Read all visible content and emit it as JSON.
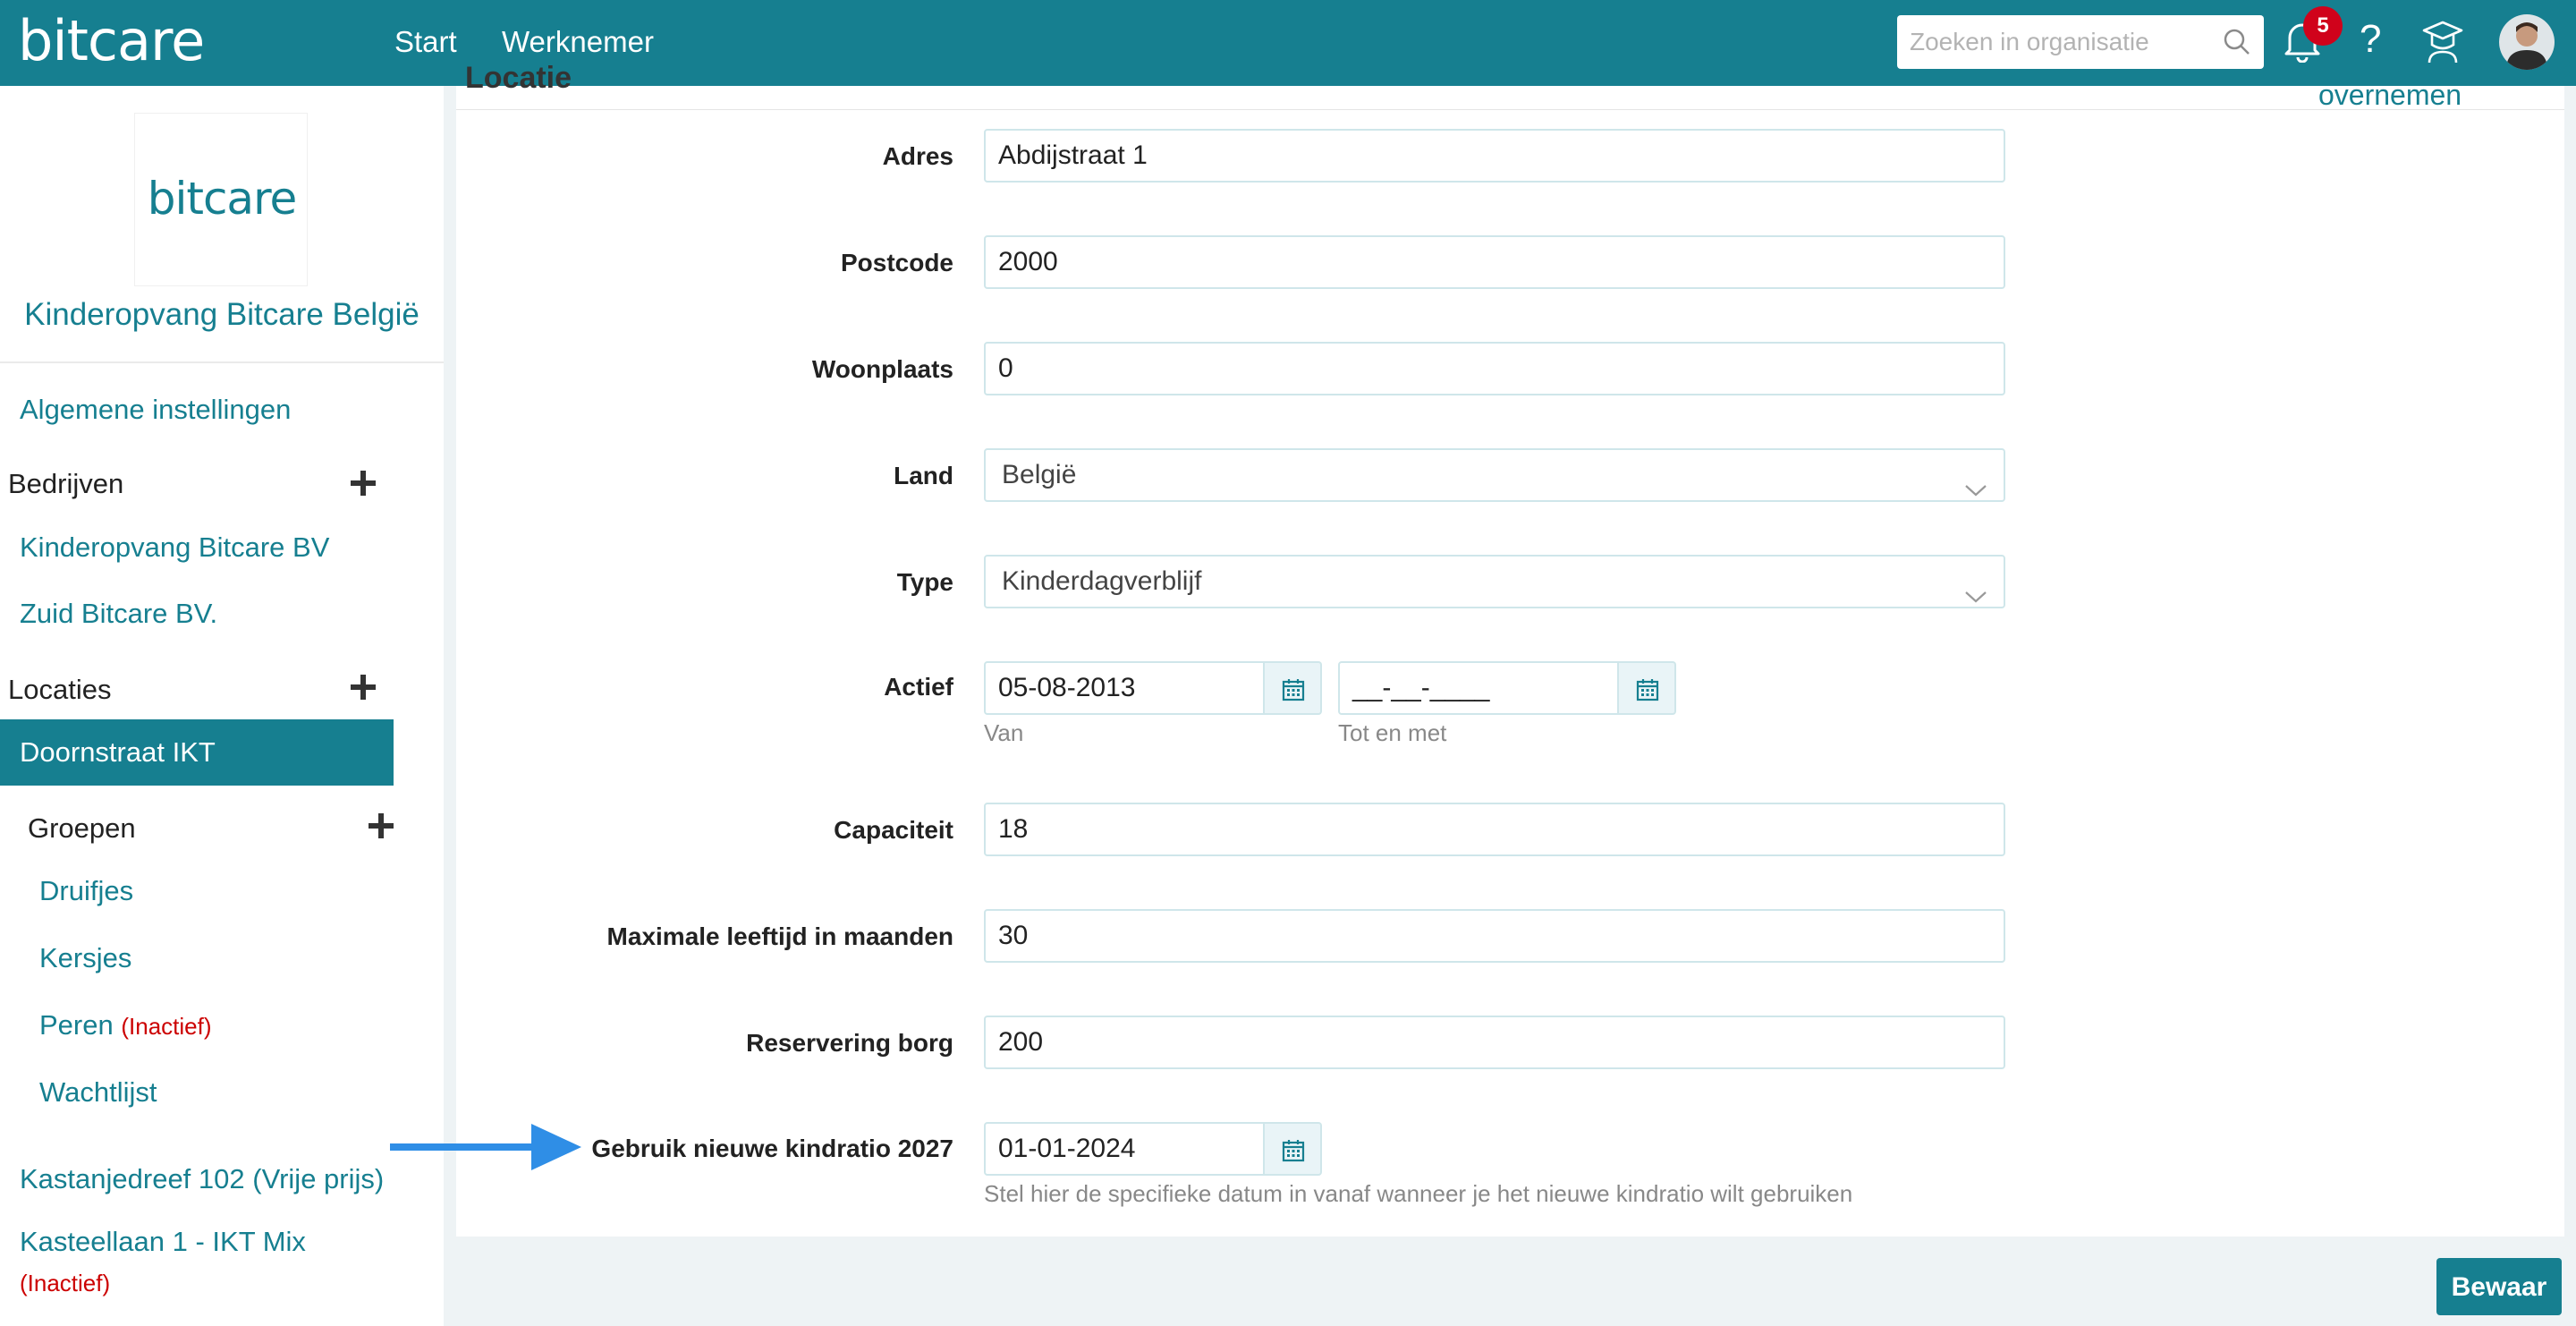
{
  "header": {
    "brand": "bitcare",
    "nav": [
      "Start",
      "Werknemer"
    ],
    "search_placeholder": "Zoeken in organisatie",
    "notification_count": "5",
    "help_label": "?"
  },
  "sidebar": {
    "logo_text": "bitcare",
    "org_name": "Kinderopvang Bitcare België",
    "general_settings": "Algemene instellingen",
    "companies_heading": "Bedrijven",
    "companies": [
      "Kinderopvang Bitcare BV",
      "Zuid Bitcare BV."
    ],
    "locations_heading": "Locaties",
    "active_location": "Doornstraat IKT",
    "groups_heading": "Groepen",
    "groups": [
      {
        "label": "Druifjes",
        "status": ""
      },
      {
        "label": "Kersjes",
        "status": ""
      },
      {
        "label": "Peren",
        "status": "(Inactief)"
      },
      {
        "label": "Wachtlijst",
        "status": ""
      }
    ],
    "other_locations": [
      {
        "label": "Kastanjedreef 102 (Vrije prijs)",
        "status": ""
      },
      {
        "label": "Kasteellaan 1 - IKT Mix",
        "status": "(Inactief)"
      }
    ]
  },
  "main": {
    "section_title": "Locatie",
    "overnemen": "overnemen",
    "fields": {
      "adres": {
        "label": "Adres",
        "value": "Abdijstraat 1"
      },
      "postcode": {
        "label": "Postcode",
        "value": "2000"
      },
      "woonplaats": {
        "label": "Woonplaats",
        "value": "0"
      },
      "land": {
        "label": "Land",
        "value": "België"
      },
      "type": {
        "label": "Type",
        "value": "Kinderdagverblijf"
      },
      "actief": {
        "label": "Actief",
        "from": "05-08-2013",
        "from_hint": "Van",
        "to": "__-__-____",
        "to_hint": "Tot en met"
      },
      "capaciteit": {
        "label": "Capaciteit",
        "value": "18"
      },
      "max_leeftijd": {
        "label": "Maximale leeftijd in maanden",
        "value": "30"
      },
      "reservering": {
        "label": "Reservering borg",
        "value": "200"
      },
      "kindratio": {
        "label": "Gebruik nieuwe kindratio 2027",
        "value": "01-01-2024",
        "hint": "Stel hier de specifieke datum in vanaf wanneer je het nieuwe kindratio wilt gebruiken"
      }
    },
    "save_label": "Bewaar"
  },
  "colors": {
    "primary": "#167f90",
    "badge": "#d0021b",
    "inactive": "#cc0000",
    "arrow": "#2f8ee6"
  }
}
